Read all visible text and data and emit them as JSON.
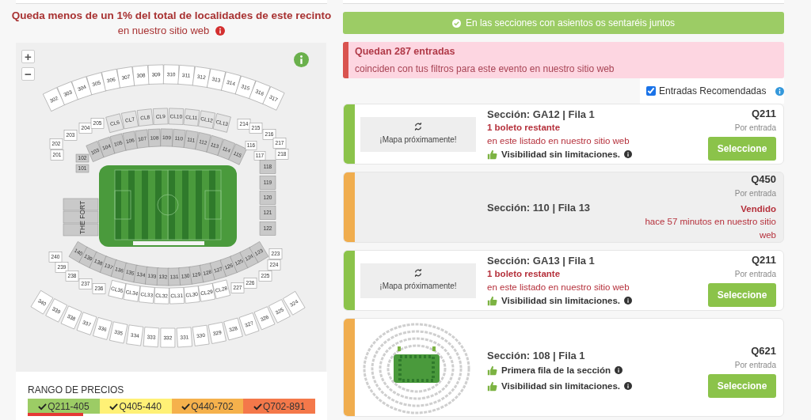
{
  "availability_notice": {
    "title": "Queda menos de un 1% del total de localidades de este recinto",
    "subtitle": "en nuestro sitio web"
  },
  "map": {
    "zoom_in": "+",
    "zoom_out": "−",
    "fort_label": "THE FORT",
    "rings": [
      {
        "kind": "upper-top",
        "sections": [
          "302",
          "303",
          "304",
          "305",
          "306",
          "307",
          "308",
          "309",
          "310",
          "311",
          "312",
          "313",
          "314",
          "315",
          "316",
          "317"
        ]
      },
      {
        "kind": "club-top",
        "sections": [
          "CL6",
          "CL7",
          "CL8",
          "CL9",
          "CL10",
          "CL11",
          "CL12",
          "CL13"
        ]
      },
      {
        "kind": "mezz-top-left",
        "sections": [
          "201",
          "202",
          "203",
          "204",
          "205"
        ]
      },
      {
        "kind": "mezz-top-right",
        "sections": [
          "214",
          "215",
          "216",
          "217",
          "218"
        ]
      },
      {
        "kind": "lower-corner-left",
        "sections": [
          "102",
          "101"
        ]
      },
      {
        "kind": "lower-top",
        "sections": [
          "103",
          "104",
          "105",
          "106",
          "107",
          "108",
          "109",
          "110",
          "111",
          "112",
          "113",
          "114",
          "115"
        ]
      },
      {
        "kind": "lower-corner-right",
        "sections": [
          "116",
          "117"
        ]
      },
      {
        "kind": "lower-side",
        "sections": [
          "118",
          "119",
          "120",
          "121",
          "122"
        ]
      },
      {
        "kind": "lower-bottom",
        "sections": [
          "140",
          "139",
          "138",
          "137",
          "136",
          "135",
          "134",
          "133",
          "132",
          "131",
          "130",
          "129",
          "128",
          "127",
          "126",
          "125",
          "124",
          "123"
        ]
      },
      {
        "kind": "mezz-bottom-left",
        "sections": [
          "240",
          "239",
          "238",
          "237",
          "236"
        ]
      },
      {
        "kind": "mezz-bottom-right",
        "sections": [
          "227",
          "226",
          "225",
          "224",
          "223"
        ]
      },
      {
        "kind": "club-bottom",
        "sections": [
          "CL35",
          "CL34",
          "CL33",
          "CL32",
          "CL31",
          "CL30",
          "CL29",
          "CL28"
        ]
      },
      {
        "kind": "upper-bottom",
        "sections": [
          "340",
          "339",
          "338",
          "337",
          "336",
          "335",
          "334",
          "333",
          "332",
          "331",
          "330",
          "329",
          "328",
          "327",
          "326",
          "325",
          "324"
        ]
      }
    ]
  },
  "price_range": {
    "title": "RANGO DE PRECIOS",
    "items": [
      {
        "label": "Q211-405",
        "color": "#9ccc65",
        "checked": true,
        "selected": true
      },
      {
        "label": "Q405-440",
        "color": "#fff176",
        "checked": true,
        "selected": false
      },
      {
        "label": "Q440-702",
        "color": "#f5b14c",
        "checked": true,
        "selected": false
      },
      {
        "label": "Q702-891",
        "color": "#f4784a",
        "checked": true,
        "selected": false
      }
    ]
  },
  "seating_banner": "En las secciones con asientos os sentaréis juntos",
  "alert": {
    "title": "Quedan 287 entradas",
    "text": "coinciden con tus filtros para este evento en nuestro sitio web"
  },
  "recommended": {
    "label": "Entradas Recomendadas",
    "checked": true
  },
  "listings": [
    {
      "kind": "available",
      "color": "#8bc34a",
      "thumbnail": {
        "kind": "placeholder",
        "text": "¡Mapa próximamente!"
      },
      "section": "Sección: GA12 | Fila 1",
      "remaining": "1 boleto restante",
      "remaining_note": "en este listado en nuestro sitio web",
      "features": [
        "Visibilidad sin limitaciones."
      ],
      "price": "Q211",
      "price_note": "Por entrada",
      "button": "Seleccione"
    },
    {
      "kind": "sold",
      "color": "#f0ad4e",
      "section": "Sección: 110 | Fila 13",
      "price": "Q450",
      "price_note": "Por entrada",
      "sold_label": "Vendido",
      "sold_note": "hace 57 minutos en nuestro sitio web"
    },
    {
      "kind": "available",
      "color": "#8bc34a",
      "thumbnail": {
        "kind": "placeholder",
        "text": "¡Mapa próximamente!"
      },
      "section": "Sección: GA13 | Fila 1",
      "remaining": "1 boleto restante",
      "remaining_note": "en este listado en nuestro sitio web",
      "features": [
        "Visibilidad sin limitaciones."
      ],
      "price": "Q211",
      "price_note": "Por entrada",
      "button": "Seleccione"
    },
    {
      "kind": "available",
      "color": "#f0ad4e",
      "thumbnail": {
        "kind": "stadium"
      },
      "section": "Sección: 108 | Fila 1",
      "features": [
        "Primera fila de la sección",
        "Visibilidad sin limitaciones."
      ],
      "price": "Q621",
      "price_note": "Por entrada",
      "button": "Seleccione"
    }
  ]
}
